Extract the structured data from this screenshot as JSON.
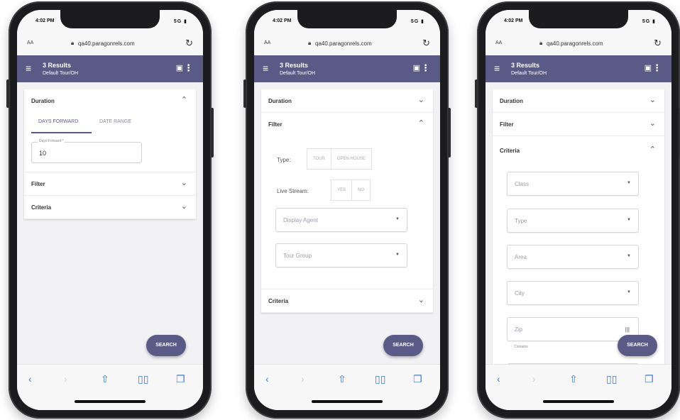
{
  "status": {
    "time": "4:02 PM",
    "signal": "5G"
  },
  "browser": {
    "aa": "AA",
    "url": "qa40.paragonrels.com"
  },
  "app": {
    "title": "3 Results",
    "subtitle": "Default Tour/OH"
  },
  "phone1": {
    "duration_label": "Duration",
    "tab_days_forward": "DAYS FORWARD",
    "tab_date_range": "DATE RANGE",
    "days_forward_label": "Days Forward *",
    "days_forward_value": "10",
    "filter_label": "Filter",
    "criteria_label": "Criteria",
    "search_label": "SEARCH"
  },
  "phone2": {
    "duration_label": "Duration",
    "filter_label": "Filter",
    "type_label": "Type:",
    "type_options": [
      "TOUR",
      "OPEN HOUSE"
    ],
    "livestream_label": "Live Stream:",
    "livestream_options": [
      "YES",
      "NO"
    ],
    "display_agent": "Display Agent",
    "tour_group": "Tour Group",
    "criteria_label": "Criteria",
    "search_label": "SEARCH"
  },
  "phone3": {
    "duration_label": "Duration",
    "filter_label": "Filter",
    "criteria_label": "Criteria",
    "class": "Class",
    "type": "Type",
    "area": "Area",
    "city": "City",
    "zip": "Zip",
    "zip_caption": "Contains",
    "search_label": "SEARCH"
  },
  "colors": {
    "accent": "#5a5a87",
    "browser_link": "#3a7bd5"
  },
  "icons": [
    "lock-icon",
    "reload-icon",
    "menu-icon",
    "save-icon",
    "more-icon",
    "chevron-up-icon",
    "chevron-down-icon",
    "dropdown-arrow-icon",
    "columns-icon",
    "back-icon",
    "forward-icon",
    "share-icon",
    "bookmarks-icon",
    "tabs-icon"
  ]
}
